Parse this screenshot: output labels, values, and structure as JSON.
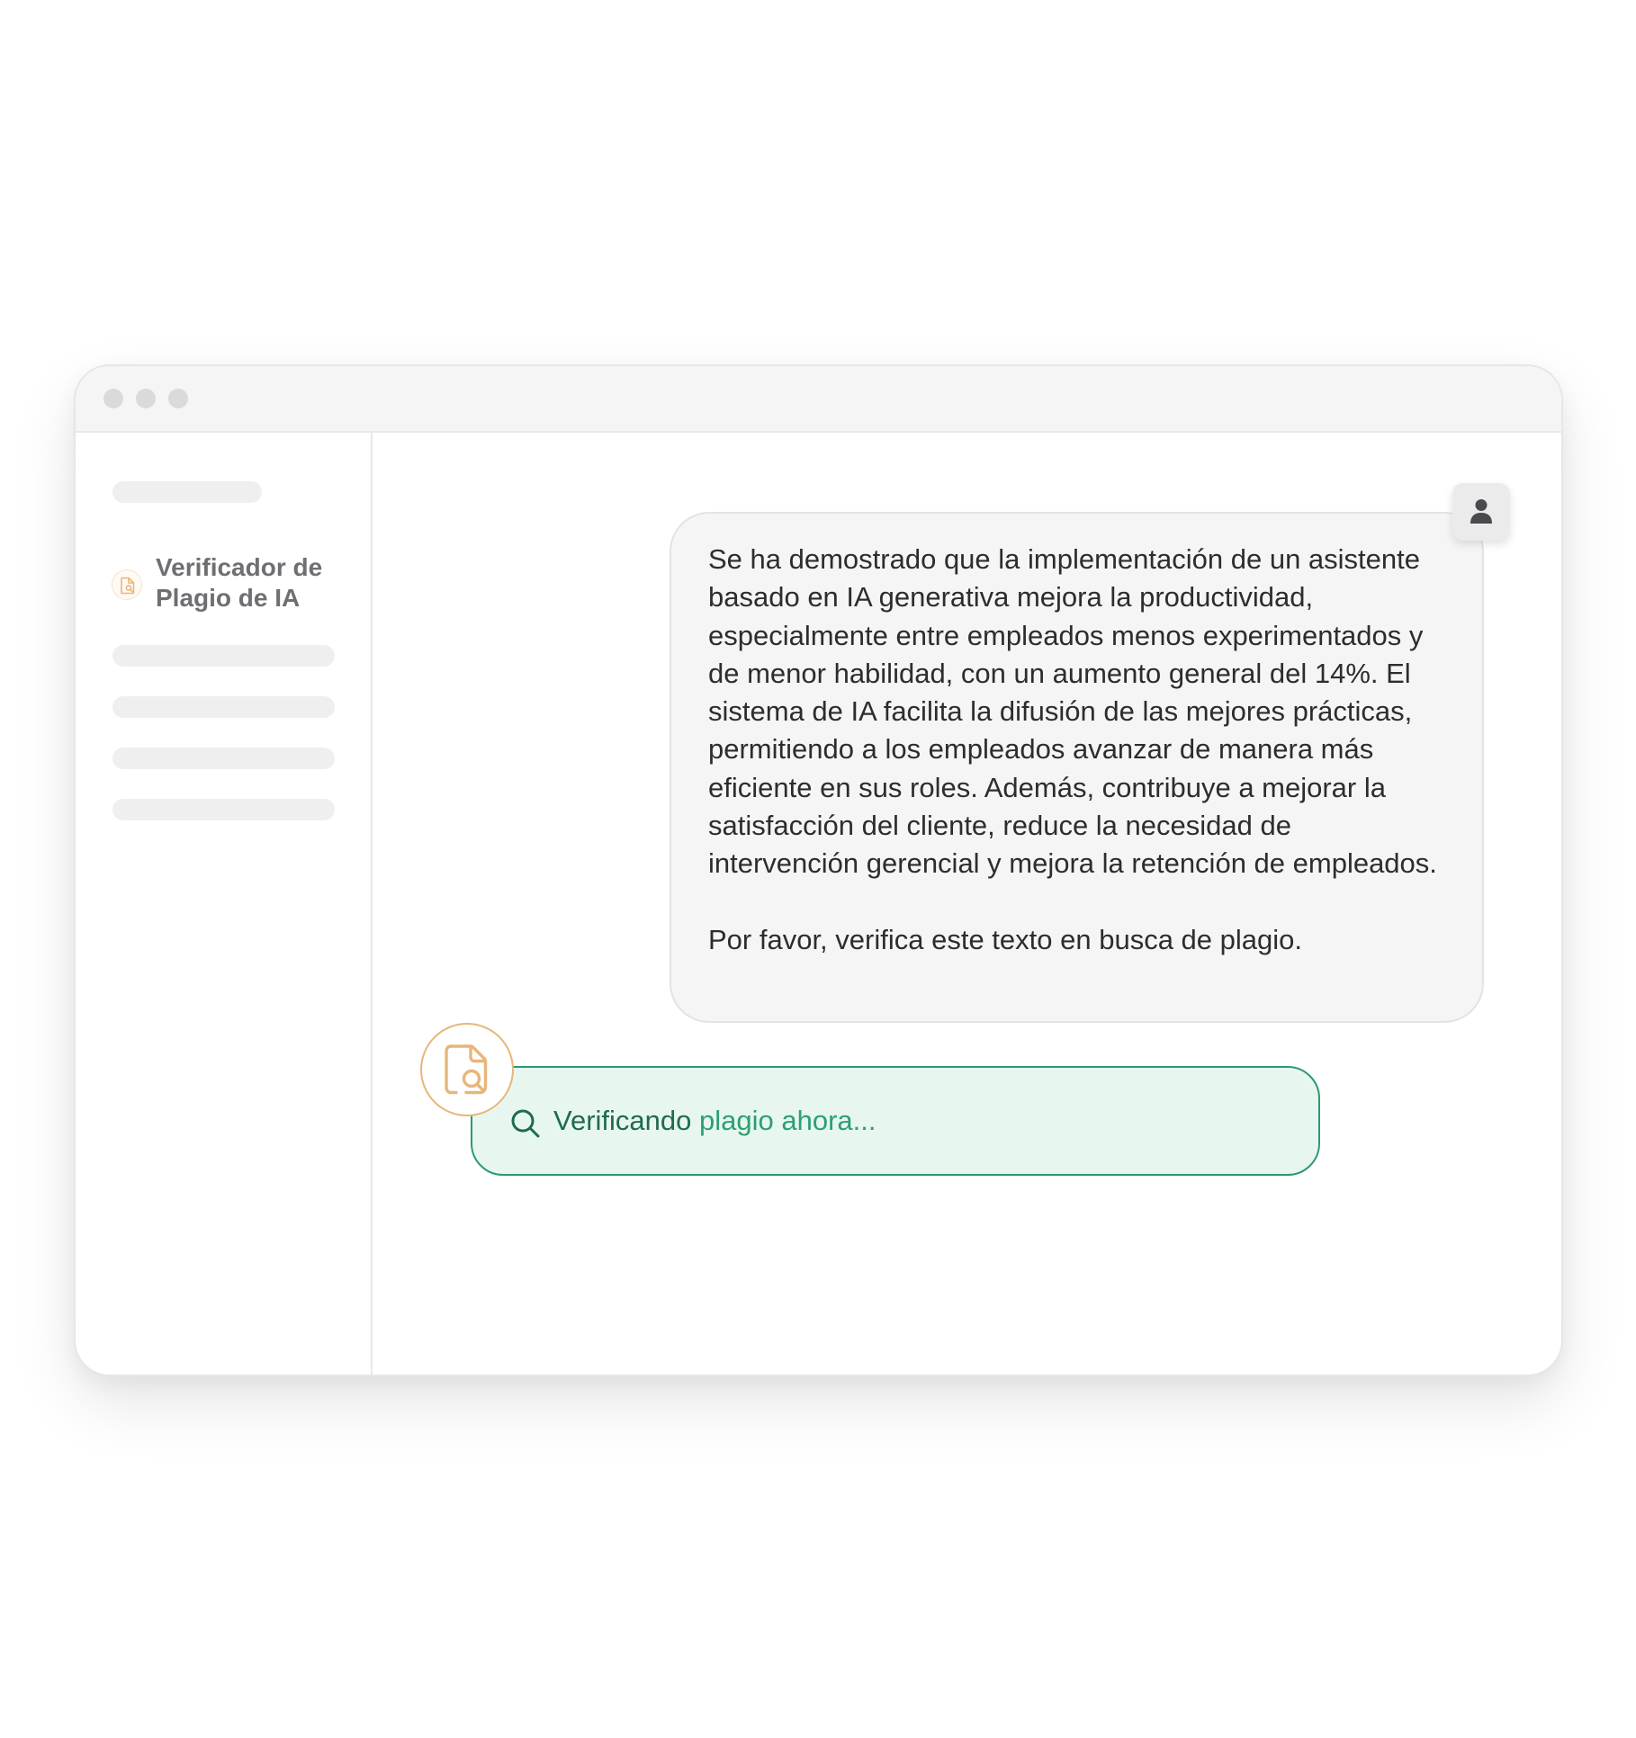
{
  "window": {
    "controls": [
      "close",
      "minimize",
      "maximize"
    ]
  },
  "sidebar": {
    "active_item": {
      "label": "Verificador de Plagio de IA",
      "icon": "document-search-icon"
    }
  },
  "chat": {
    "user_message": {
      "paragraph_1": "Se ha demostrado que la implementación de un asistente basado en IA generativa mejora la productividad, especialmente entre empleados menos experimentados y de menor habilidad, con un aumento general del 14%. El sistema de IA facilita la difusión de las mejores prácticas, permitiendo a los empleados avanzar de manera más eficiente en sus roles. Además, contribuye a mejorar la satisfacción del cliente, reduce la necesidad de intervención gerencial y mejora la retención de empleados.",
      "paragraph_2": "Por favor, verifica este texto en busca de plagio.",
      "avatar_icon": "user-icon"
    },
    "assistant_status": {
      "word_1": "Verificando",
      "word_2": " plagio ahora...",
      "icon": "search-icon",
      "avatar_icon": "document-search-icon"
    }
  },
  "colors": {
    "accent_orange": "#e7b67a",
    "status_green": "#2c9a6e",
    "status_bg": "#e8f6f0",
    "bubble_bg": "#f5f5f5"
  }
}
